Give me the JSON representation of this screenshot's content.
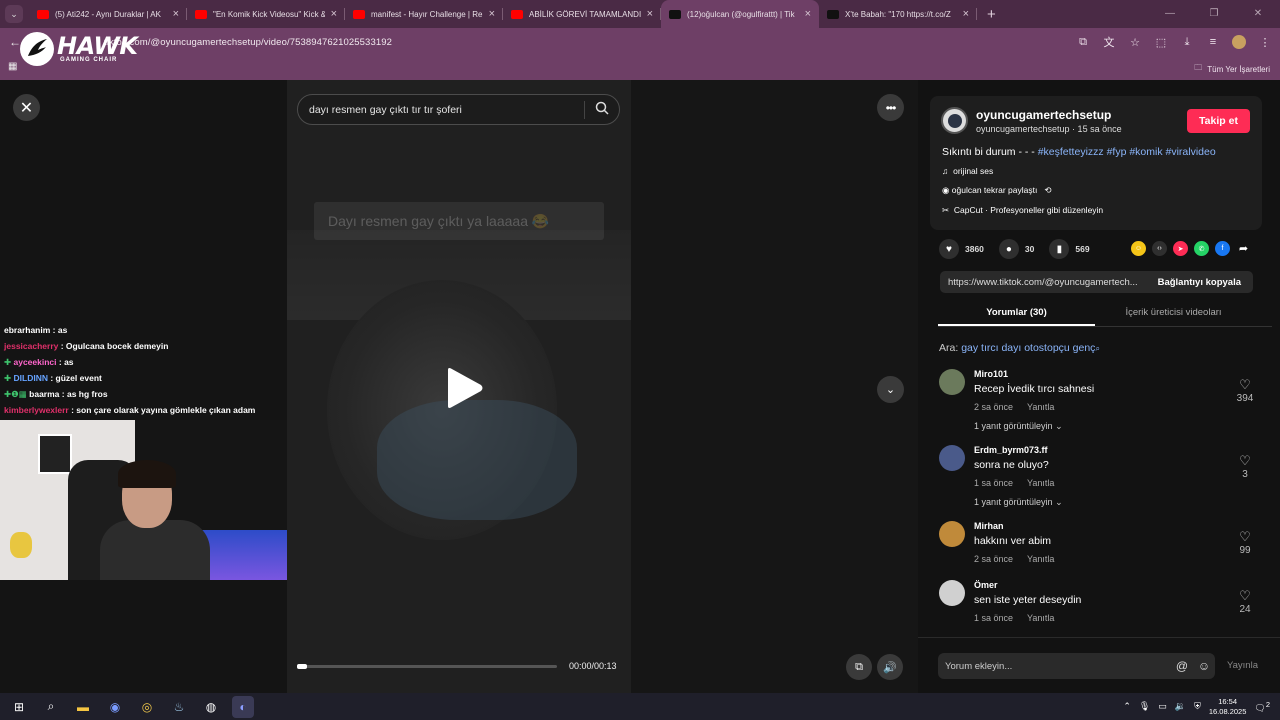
{
  "browser": {
    "tabs": [
      {
        "title": "(5) Ati242 - Aynı Duraklar | AK",
        "color": "#ff0000",
        "active": false
      },
      {
        "title": "\"En Komik Kick Videosu\" Kick &",
        "color": "#ff0000",
        "active": false
      },
      {
        "title": "manifest - Hayır Challenge | Re",
        "color": "#ff0000",
        "active": false
      },
      {
        "title": "ABİLİK GÖREVİ TAMAMLANDI !",
        "color": "#ff0000",
        "active": false
      },
      {
        "title": "(12)oğulcan (@ogulfirattt) | Tik",
        "color": "#111111",
        "active": true
      },
      {
        "title": "X'te Babah: \"170 https://t.co/Z",
        "color": "#111111",
        "active": false
      }
    ],
    "new_tab": "+",
    "url": "tiktok.com/@oyuncugamertechsetup/video/7538947621025533192",
    "bookmarks_label": "Tüm Yer İşaretleri"
  },
  "overlay_logo": {
    "brand": "HAWK",
    "subtitle": "GAMING CHAIR"
  },
  "video": {
    "search_placeholder": "dayı resmen gay çıktı tır tır şoferi",
    "ghost_caption": "Dayı resmen gay çıktı ya laaaaa 😂",
    "time": "00:00/00:13",
    "progress": 0.0
  },
  "chat": [
    {
      "user": "ebrarhanim",
      "color": "#ffffff",
      "badge": "",
      "msg": "as"
    },
    {
      "user": "jessicacherry",
      "color": "#e0306a",
      "badge": "",
      "msg": "Ogulcana bocek demeyin"
    },
    {
      "user": "ayceekinci",
      "color": "#ff66cc",
      "badge": "✚",
      "msg": "as"
    },
    {
      "user": "DILDINN",
      "color": "#66a3ff",
      "badge": "✚",
      "msg": "güzel event"
    },
    {
      "user": "baarma",
      "color": "#ffffff",
      "badge": "✚❶▦",
      "msg": "as hg fros"
    },
    {
      "user": "kimberlywexlerr",
      "color": "#e0306a",
      "badge": "",
      "msg": "son çare olarak yayına gömlekle çıkan adam"
    }
  ],
  "post": {
    "username": "oyuncugamertechsetup",
    "subline": "oyuncugamertechsetup · 15 sa önce",
    "follow": "Takip et",
    "desc_text": "Sıkıntı bi durum - - - ",
    "desc_tags": "#keşfetteyizzz #fyp #komik #viralvideo",
    "music": "orijinal ses",
    "repost": "oğulcan tekrar paylaştı",
    "capcut": "CapCut · Profesyoneller gibi düzenleyin",
    "likes": "3860",
    "comments": "30",
    "saves": "569",
    "link": "https://www.tiktok.com/@oyuncugamertech...",
    "copy_link": "Bağlantıyı kopyala",
    "tab_comments": "Yorumlar (30)",
    "tab_creator": "İçerik üreticisi videoları",
    "related_label": "Ara:",
    "related_query": "gay tırcı dayı otostopçu genç"
  },
  "comments": [
    {
      "user": "Miro101",
      "text": "Recep İvedik tırcı sahnesi",
      "time": "2 sa önce",
      "reply": "Yanıtla",
      "likes": "394",
      "more": "1 yanıt görüntüleyin",
      "avatar": "#6b7a5c"
    },
    {
      "user": "Erdm_byrm073.ff",
      "text": "sonra ne oluyo?",
      "time": "1 sa önce",
      "reply": "Yanıtla",
      "likes": "3",
      "more": "1 yanıt görüntüleyin",
      "avatar": "#4a5a8a"
    },
    {
      "user": "Mirhan",
      "text": "hakkını ver abim",
      "time": "2 sa önce",
      "reply": "Yanıtla",
      "likes": "99",
      "more": "",
      "avatar": "#c08a3a"
    },
    {
      "user": "Ömer",
      "text": "sen iste yeter deseydin",
      "time": "1 sa önce",
      "reply": "Yanıtla",
      "likes": "24",
      "more": "",
      "avatar": "#d0d0d0"
    }
  ],
  "comment_input": {
    "placeholder": "Yorum ekleyin...",
    "post": "Yayınla"
  },
  "taskbar": {
    "time": "16:54",
    "date": "16.08.2025",
    "notif": "2"
  }
}
